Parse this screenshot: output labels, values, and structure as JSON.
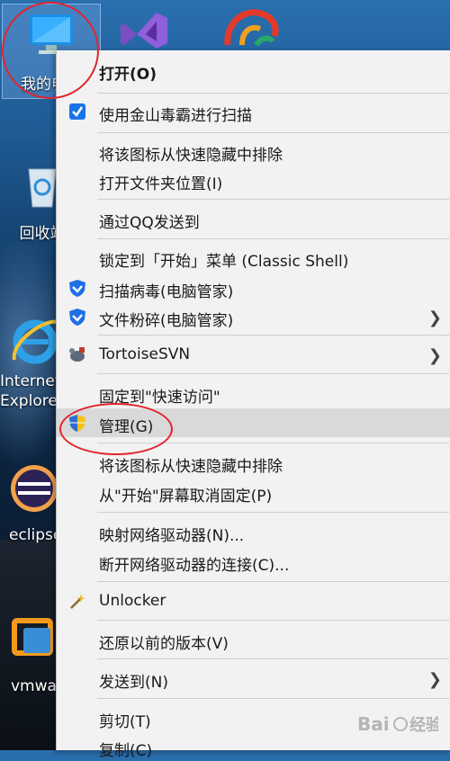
{
  "desktop": {
    "icons": [
      {
        "label": "我的电脑"
      },
      {
        "label": "回收站"
      },
      {
        "label": "Internet Explorer"
      },
      {
        "label": "eclipse"
      },
      {
        "label": "vmware"
      }
    ]
  },
  "menu": {
    "items": [
      {
        "label": "打开(O)"
      },
      {
        "label": "使用金山毒霸进行扫描"
      },
      {
        "label": "将该图标从快速隐藏中排除"
      },
      {
        "label": "打开文件夹位置(I)"
      },
      {
        "label": "通过QQ发送到"
      },
      {
        "label": "锁定到「开始」菜单 (Classic Shell)"
      },
      {
        "label": "扫描病毒(电脑管家)"
      },
      {
        "label": "文件粉碎(电脑管家)"
      },
      {
        "label": "TortoiseSVN"
      },
      {
        "label": "固定到\"快速访问\""
      },
      {
        "label": "管理(G)"
      },
      {
        "label": "将该图标从快速隐藏中排除"
      },
      {
        "label": "从\"开始\"屏幕取消固定(P)"
      },
      {
        "label": "映射网络驱动器(N)..."
      },
      {
        "label": "断开网络驱动器的连接(C)..."
      },
      {
        "label": "Unlocker"
      },
      {
        "label": "还原以前的版本(V)"
      },
      {
        "label": "发送到(N)"
      },
      {
        "label": "剪切(T)"
      },
      {
        "label": "复制(C)"
      }
    ]
  },
  "colors": {
    "highlight_ring": "#e1252c",
    "menu_bg": "#f2f2f2",
    "hover_bg": "#d9d9d9"
  }
}
